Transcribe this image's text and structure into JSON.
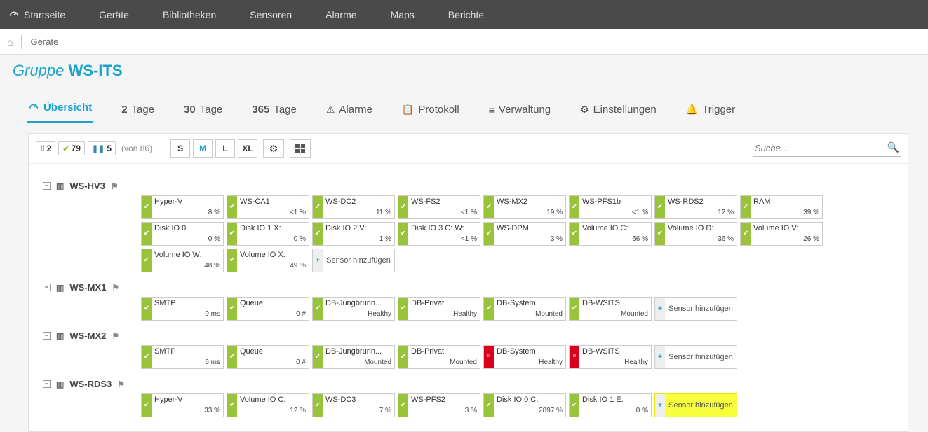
{
  "topnav": [
    {
      "label": "Startseite",
      "icon": "gauge"
    },
    {
      "label": "Geräte"
    },
    {
      "label": "Bibliotheken"
    },
    {
      "label": "Sensoren"
    },
    {
      "label": "Alarme"
    },
    {
      "label": "Maps"
    },
    {
      "label": "Berichte"
    }
  ],
  "breadcrumb": {
    "item": "Geräte"
  },
  "page_title": {
    "prefix": "Gruppe",
    "name": "WS-ITS"
  },
  "tabs": [
    {
      "label": "Übersicht",
      "icon": "gauge",
      "active": true
    },
    {
      "bold": "2",
      "label": "Tage"
    },
    {
      "bold": "30",
      "label": "Tage"
    },
    {
      "bold": "365",
      "label": "Tage"
    },
    {
      "label": "Alarme",
      "icon": "⚠"
    },
    {
      "label": "Protokoll",
      "icon": "📋"
    },
    {
      "label": "Verwaltung",
      "icon": "≡"
    },
    {
      "label": "Einstellungen",
      "icon": "⚙"
    },
    {
      "label": "Trigger",
      "icon": "🔔"
    }
  ],
  "toolbar": {
    "status": {
      "error": "2",
      "ok": "79",
      "paused": "5",
      "of": "(von 86)"
    },
    "sizes": [
      "S",
      "M",
      "L",
      "XL"
    ],
    "active_size": "M",
    "search_placeholder": "Suche..."
  },
  "add_sensor_label": "Sensor hinzufügen",
  "devices": [
    {
      "name": "WS-HV3",
      "sensors": [
        {
          "name": "Hyper-V",
          "value": "8 %",
          "state": "ok"
        },
        {
          "name": "WS-CA1",
          "value": "<1 %",
          "state": "ok"
        },
        {
          "name": "WS-DC2",
          "value": "11 %",
          "state": "ok"
        },
        {
          "name": "WS-FS2",
          "value": "<1 %",
          "state": "ok"
        },
        {
          "name": "WS-MX2",
          "value": "19 %",
          "state": "ok"
        },
        {
          "name": "WS-PFS1b",
          "value": "<1 %",
          "state": "ok"
        },
        {
          "name": "WS-RDS2",
          "value": "12 %",
          "state": "ok"
        },
        {
          "name": "RAM",
          "value": "39 %",
          "state": "ok"
        },
        {
          "name": "Disk IO 0",
          "value": "0 %",
          "state": "ok"
        },
        {
          "name": "Disk IO 1 X:",
          "value": "0 %",
          "state": "ok"
        },
        {
          "name": "Disk IO 2 V:",
          "value": "1 %",
          "state": "ok"
        },
        {
          "name": "Disk IO 3 C: W:",
          "value": "<1 %",
          "state": "ok"
        },
        {
          "name": "WS-DPM",
          "value": "3 %",
          "state": "ok"
        },
        {
          "name": "Volume IO C:",
          "value": "66 %",
          "state": "ok"
        },
        {
          "name": "Volume IO D:",
          "value": "36 %",
          "state": "ok"
        },
        {
          "name": "Volume IO V:",
          "value": "26 %",
          "state": "ok"
        },
        {
          "name": "Volume IO W:",
          "value": "48 %",
          "state": "ok"
        },
        {
          "name": "Volume IO X:",
          "value": "49 %",
          "state": "ok"
        }
      ],
      "add_highlight": false
    },
    {
      "name": "WS-MX1",
      "sensors": [
        {
          "name": "SMTP",
          "value": "9 ms",
          "state": "ok"
        },
        {
          "name": "Queue",
          "value": "0 #",
          "state": "ok"
        },
        {
          "name": "DB-Jungbrunn...",
          "value": "Healthy",
          "state": "ok"
        },
        {
          "name": "DB-Privat",
          "value": "Healthy",
          "state": "ok"
        },
        {
          "name": "DB-System",
          "value": "Mounted",
          "state": "ok"
        },
        {
          "name": "DB-WSITS",
          "value": "Mounted",
          "state": "ok"
        }
      ],
      "add_highlight": false
    },
    {
      "name": "WS-MX2",
      "sensors": [
        {
          "name": "SMTP",
          "value": "6 ms",
          "state": "ok"
        },
        {
          "name": "Queue",
          "value": "0 #",
          "state": "ok"
        },
        {
          "name": "DB-Jungbrunn...",
          "value": "Mounted",
          "state": "ok"
        },
        {
          "name": "DB-Privat",
          "value": "Mounted",
          "state": "ok"
        },
        {
          "name": "DB-System",
          "value": "Healthy",
          "state": "err"
        },
        {
          "name": "DB-WSITS",
          "value": "Healthy",
          "state": "err"
        }
      ],
      "add_highlight": false
    },
    {
      "name": "WS-RDS3",
      "sensors": [
        {
          "name": "Hyper-V",
          "value": "33 %",
          "state": "ok"
        },
        {
          "name": "Volume IO C:",
          "value": "12 %",
          "state": "ok"
        },
        {
          "name": "WS-DC3",
          "value": "7 %",
          "state": "ok"
        },
        {
          "name": "WS-PFS2",
          "value": "3 %",
          "state": "ok"
        },
        {
          "name": "Disk IO 0 C:",
          "value": "2897 %",
          "state": "ok"
        },
        {
          "name": "Disk IO 1 E:",
          "value": "0 %",
          "state": "ok"
        }
      ],
      "add_highlight": true
    }
  ]
}
